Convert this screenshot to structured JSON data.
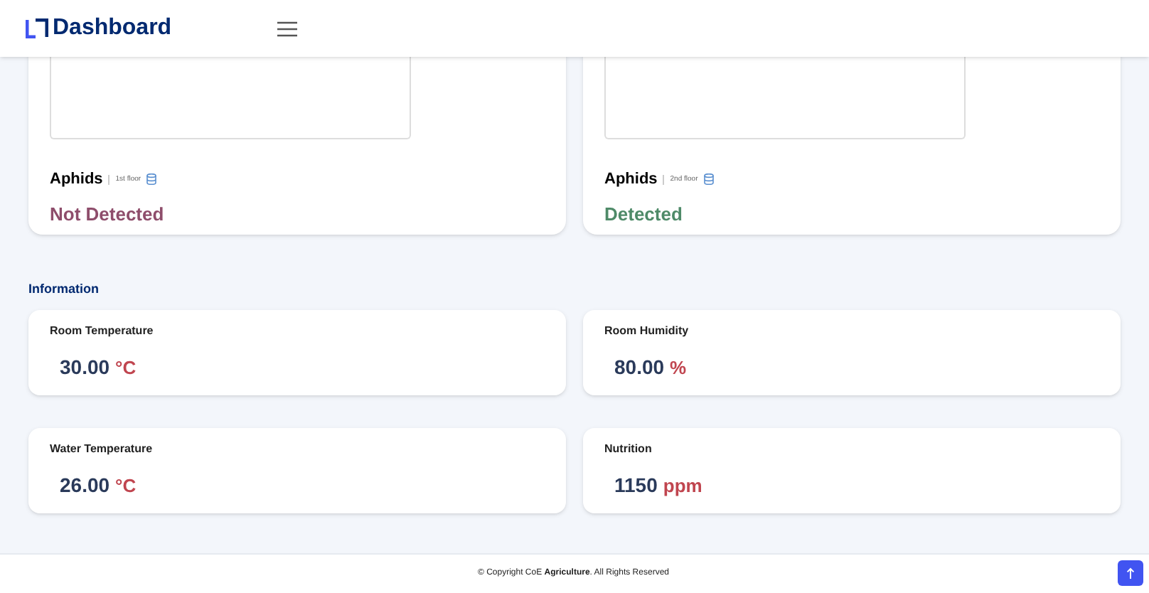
{
  "header": {
    "title": "Dashboard"
  },
  "sensors": [
    {
      "name": "Aphids",
      "floor": "1st floor",
      "status": "Not Detected",
      "detected": false
    },
    {
      "name": "Aphids",
      "floor": "2nd floor",
      "status": "Detected",
      "detected": true
    }
  ],
  "information": {
    "heading": "Information",
    "cards": [
      {
        "label": "Room Temperature",
        "value": "30.00",
        "unit": "°C"
      },
      {
        "label": "Room Humidity",
        "value": "80.00",
        "unit": "%"
      },
      {
        "label": "Water Temperature",
        "value": "26.00",
        "unit": "°C"
      },
      {
        "label": "Nutrition",
        "value": "1150",
        "unit": "ppm"
      }
    ]
  },
  "footer": {
    "text": "© Copyright CoE **Agriculture**. All Rights Reserved"
  }
}
